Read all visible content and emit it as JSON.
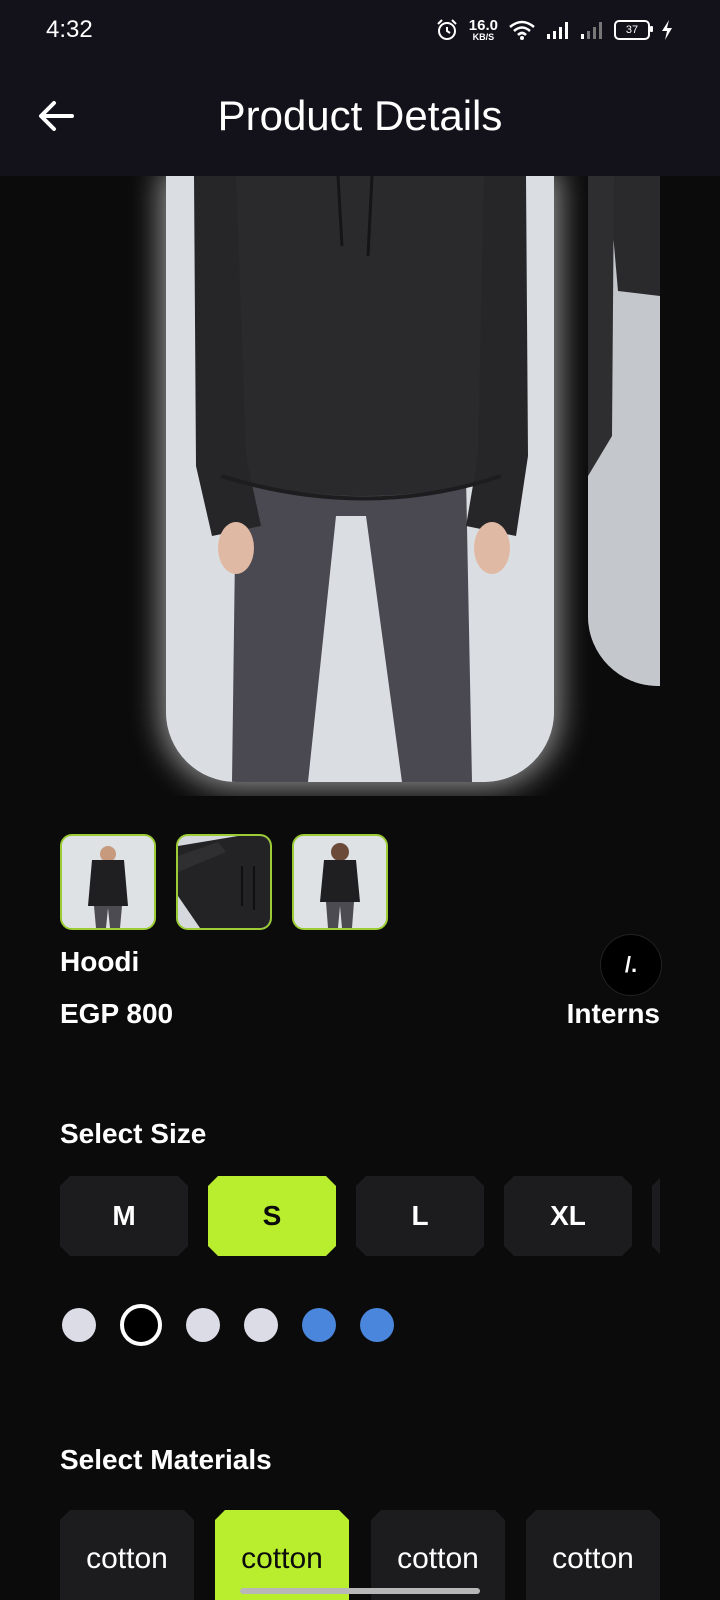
{
  "status_bar": {
    "time": "4:32",
    "net_speed_value": "16.0",
    "net_speed_unit": "KB/S",
    "battery": "37",
    "icons": [
      "alarm-icon",
      "wifi-icon",
      "signal-icon",
      "signal-icon",
      "battery-icon",
      "charging-icon"
    ]
  },
  "app_bar": {
    "title": "Product Details",
    "back_icon": "arrow-left-icon"
  },
  "product": {
    "name": "Hoodi",
    "price": "EGP 800",
    "brand_name": "Interns",
    "brand_logo_text": "/."
  },
  "gallery": {
    "thumbnail_count": 3
  },
  "size_section": {
    "title": "Select Size",
    "sizes": [
      "M",
      "S",
      "L",
      "XL"
    ],
    "selected_size": "S"
  },
  "colors": {
    "swatches": [
      "#dcdce6",
      "#000000",
      "#dcdce6",
      "#dcdce6",
      "#4a86dc",
      "#4a86dc"
    ],
    "selected_index": 1
  },
  "materials_section": {
    "title": "Select Materials",
    "materials": [
      "cotton",
      "cotton",
      "cotton",
      "cotton"
    ],
    "selected_index": 1
  },
  "theme": {
    "accent": "#b9ee2f",
    "thumb_border": "#9bcc34",
    "background": "#0b0b0c",
    "bar_background": "#13111a"
  }
}
